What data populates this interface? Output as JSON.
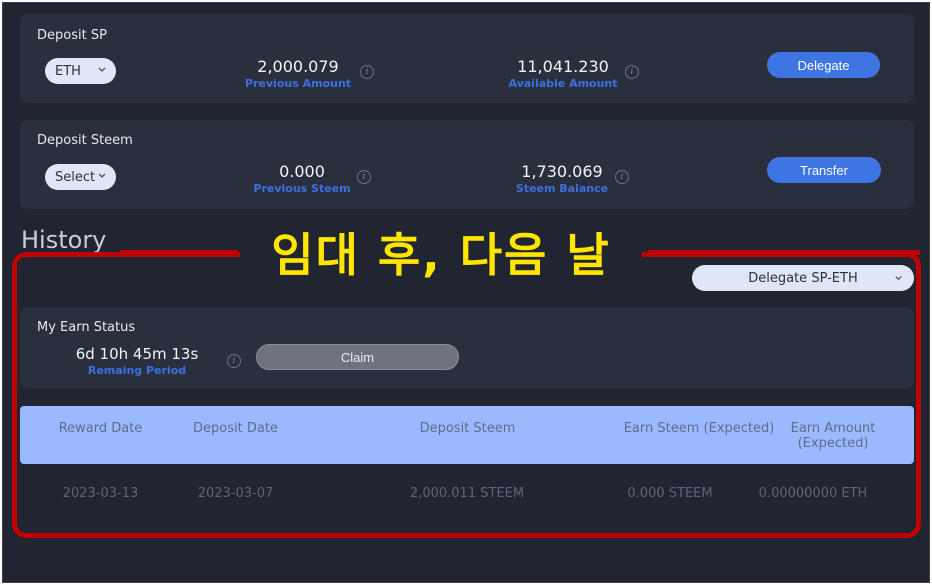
{
  "deposit_sp": {
    "title": "Deposit SP",
    "select_value": "ETH",
    "previous_amount": "2,000.079",
    "previous_amount_label": "Previous Amount",
    "available_amount": "11,041.230",
    "available_amount_label": "Available Amount",
    "button_label": "Delegate"
  },
  "deposit_steem": {
    "title": "Deposit Steem",
    "select_value": "Select",
    "previous_steem": "0.000",
    "previous_steem_label": "Previous Steem",
    "steem_balance": "1,730.069",
    "steem_balance_label": "Steem Balance",
    "button_label": "Transfer"
  },
  "history": {
    "title": "History",
    "annotation": "임대 후, 다음 날",
    "select_value": "Delegate SP-ETH"
  },
  "earn_status": {
    "title": "My Earn Status",
    "period": "6d 10h 45m 13s",
    "period_label": "Remaing Period",
    "claim_label": "Claim"
  },
  "table": {
    "headers": [
      "Reward Date",
      "Deposit Date",
      "Deposit Steem",
      "Earn Steem (Expected)",
      "Earn Amount",
      "(Expected)"
    ],
    "rows": [
      [
        "2023-03-13",
        "2023-03-07",
        "2,000.011 STEEM",
        "0.000 STEEM",
        "0.00000000 ETH"
      ]
    ]
  },
  "colors": {
    "background": "#212532",
    "card": "#2a2f3e",
    "accent_blue": "#3f74e3",
    "label_blue": "#3d6fe0",
    "table_header": "#9ab9ff",
    "annotation_red": "#c00000",
    "annotation_yellow": "#ffe500"
  },
  "icons": [
    "info-icon",
    "chevron-down-icon"
  ]
}
